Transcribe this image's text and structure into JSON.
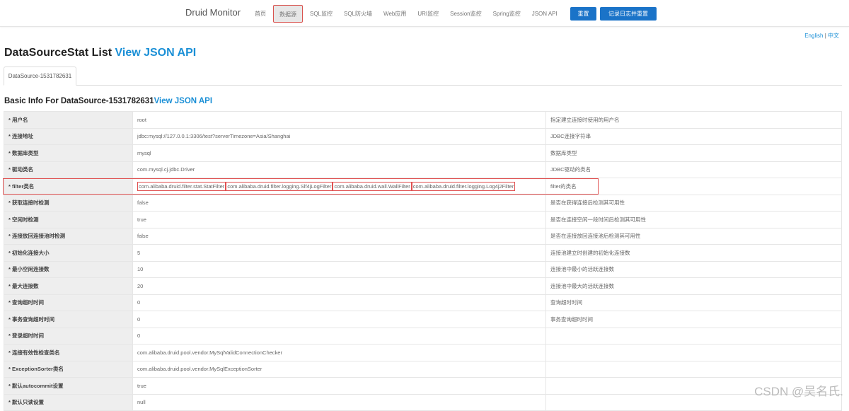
{
  "nav": {
    "brand": "Druid Monitor",
    "items": [
      "首页",
      "数据源",
      "SQL监控",
      "SQL防火墙",
      "Web应用",
      "URI监控",
      "Session监控",
      "Spring监控",
      "JSON API"
    ],
    "active": 1,
    "reset": "重置",
    "log_reset": "记录日志并重置"
  },
  "lang": {
    "en": "English",
    "sep": "|",
    "zh": "中文"
  },
  "title": "DataSourceStat List ",
  "title_link": "View JSON API",
  "tab": "DataSource-1531782631",
  "section": "Basic Info For DataSource-1531782631",
  "section_link": "View JSON API",
  "rows": [
    {
      "k": "用户名",
      "v": "root",
      "d": "指定建立连接时使用的用户名"
    },
    {
      "k": "连接地址",
      "v": "jdbc:mysql://127.0.0.1:3306/test?serverTimezone=Asia/Shanghai",
      "d": "JDBC连接字符串"
    },
    {
      "k": "数据库类型",
      "v": "mysql",
      "d": "数据库类型"
    },
    {
      "k": "驱动类名",
      "v": "com.mysql.cj.jdbc.Driver",
      "d": "JDBC驱动的类名"
    },
    {
      "k": "filter类名",
      "filters": [
        "com.alibaba.druid.filter.stat.StatFilter",
        "com.alibaba.druid.filter.logging.Slf4jLogFilter",
        "com.alibaba.druid.wall.WallFilter",
        "com.alibaba.druid.filter.logging.Log4j2Filter"
      ],
      "d": "filter的类名"
    },
    {
      "k": "获取连接时检测",
      "v": "false",
      "d": "是否在获得连接后检测其可用性"
    },
    {
      "k": "空闲时检测",
      "v": "true",
      "d": "是否在连接空闲一段时间后检测其可用性"
    },
    {
      "k": "连接放回连接池时检测",
      "v": "false",
      "d": "是否在连接放回连接池后检测其可用性"
    },
    {
      "k": "初始化连接大小",
      "v": "5",
      "d": "连接池建立时创建的初始化连接数"
    },
    {
      "k": "最小空闲连接数",
      "v": "10",
      "d": "连接池中最小的活跃连接数"
    },
    {
      "k": "最大连接数",
      "v": "20",
      "d": "连接池中最大的活跃连接数"
    },
    {
      "k": "查询超时时间",
      "v": "0",
      "d": "查询超时时间"
    },
    {
      "k": "事务查询超时时间",
      "v": "0",
      "d": "事务查询超时时间"
    },
    {
      "k": "登录超时时间",
      "v": "0",
      "d": ""
    },
    {
      "k": "连接有效性检查类名",
      "v": "com.alibaba.druid.pool.vendor.MySqlValidConnectionChecker",
      "d": ""
    },
    {
      "k": "ExceptionSorter类名",
      "v": "com.alibaba.druid.pool.vendor.MySqlExceptionSorter",
      "d": ""
    },
    {
      "k": "默认autocommit设置",
      "v": "true",
      "d": ""
    },
    {
      "k": "默认只读设置",
      "v": "null",
      "d": ""
    }
  ],
  "watermark": "CSDN @吴名氏."
}
